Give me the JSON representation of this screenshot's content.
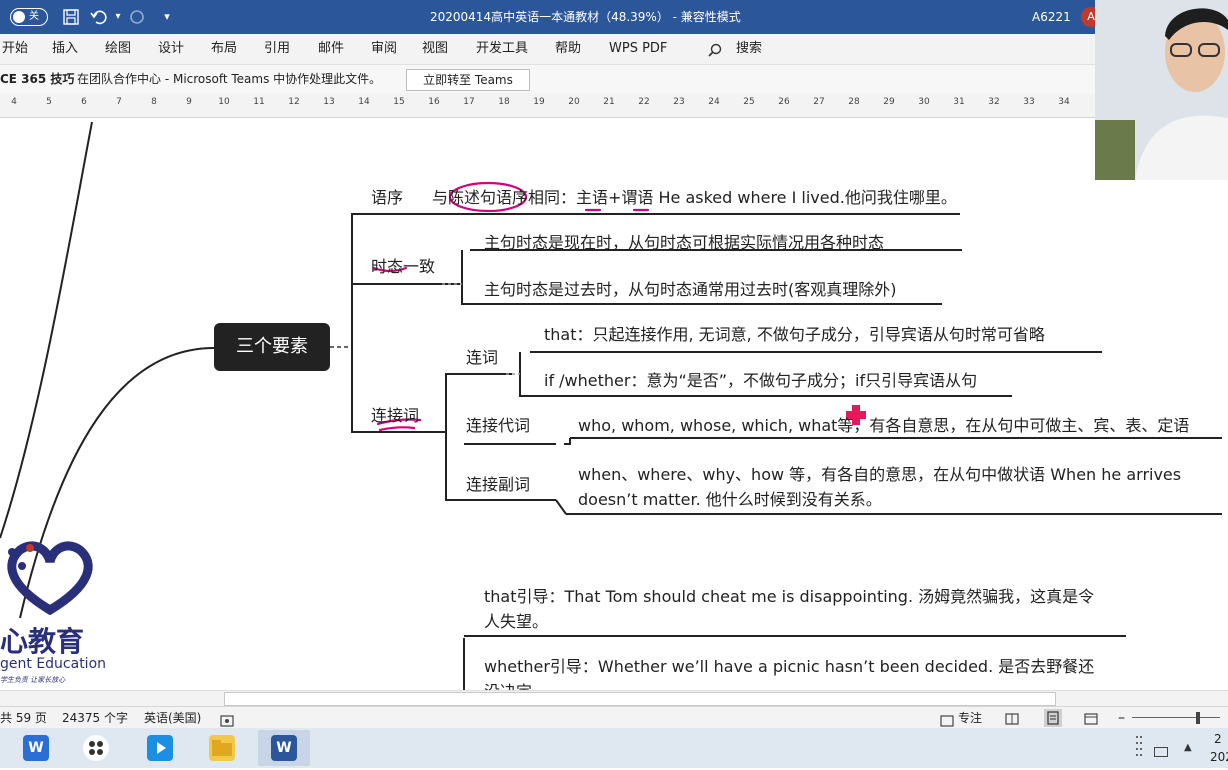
{
  "titlebar": {
    "autosave_state": "关",
    "document_title": "20200414高中英语一本通教材（48.39%） - 兼容性模式",
    "account_code": "A6221",
    "avatar_letter": "A"
  },
  "ribbon": {
    "tabs": [
      "开始",
      "插入",
      "绘图",
      "设计",
      "布局",
      "引用",
      "邮件",
      "审阅",
      "视图",
      "开发工具",
      "帮助",
      "WPS PDF"
    ],
    "search_label": "搜索"
  },
  "infobar": {
    "tip_title": "CE 365 技巧",
    "message": "在团队合作中心 - Microsoft Teams 中协作处理此文件。",
    "button_label": "立即转至 Teams"
  },
  "ruler": {
    "ticks": [
      "4",
      "5",
      "6",
      "7",
      "8",
      "9",
      "10",
      "11",
      "12",
      "13",
      "14",
      "15",
      "16",
      "17",
      "18",
      "19",
      "20",
      "21",
      "22",
      "23",
      "24",
      "25",
      "26",
      "27",
      "28",
      "29",
      "30",
      "31",
      "32",
      "33",
      "34"
    ]
  },
  "mindmap": {
    "central": "三个要素",
    "word_order": {
      "label": "语序",
      "text": "与陈述句语序相同：主语+谓语  He asked where I lived.他问我住哪里。"
    },
    "tense": {
      "label": "时态一致",
      "items": [
        "主句时态是现在时，从句时态可根据实际情况用各种时态",
        "主句时态是过去时，从句时态通常用过去时(客观真理除外)"
      ]
    },
    "connectives": {
      "label": "连接词",
      "conj_label": "连词",
      "conj_items": [
        "that：只起连接作用, 无词意, 不做句子成分，引导宾语从句时常可省略",
        "if /whether：意为“是否”，不做句子成分；if只引导宾语从句"
      ],
      "pronoun_label": "连接代词",
      "pronoun_text": "who, whom, whose, which, what等，有各自意思，在从句中可做主、宾、表、定语",
      "adverb_label": "连接副词",
      "adverb_text": "when、where、why、how 等，有各自的意思，在从句中做状语 When he arrives doesn’t matter. 他什么时候到没有关系。"
    },
    "examples": [
      "that引导：That Tom should cheat me is disappointing. 汤姆竟然骗我，这真是令人失望。",
      "whether引导：Whether we’ll have a picnic hasn’t been decided. 是否去野餐还没决定。"
    ]
  },
  "watermark": {
    "name": "心教育",
    "english": "gent Education",
    "slogan": "学生负责  让家长放心"
  },
  "status": {
    "pages": "共 59 页",
    "words": "24375 个字",
    "language": "英语(美国)",
    "focus": "专注"
  },
  "taskbar": {
    "word_label": "W",
    "clock_line1": "2",
    "clock_line2": "202"
  },
  "colors": {
    "titlebar": "#2b579a",
    "annotation": "#d6007a",
    "annotation_cursor": "#e6195b",
    "watermark": "#2a2f7a"
  }
}
